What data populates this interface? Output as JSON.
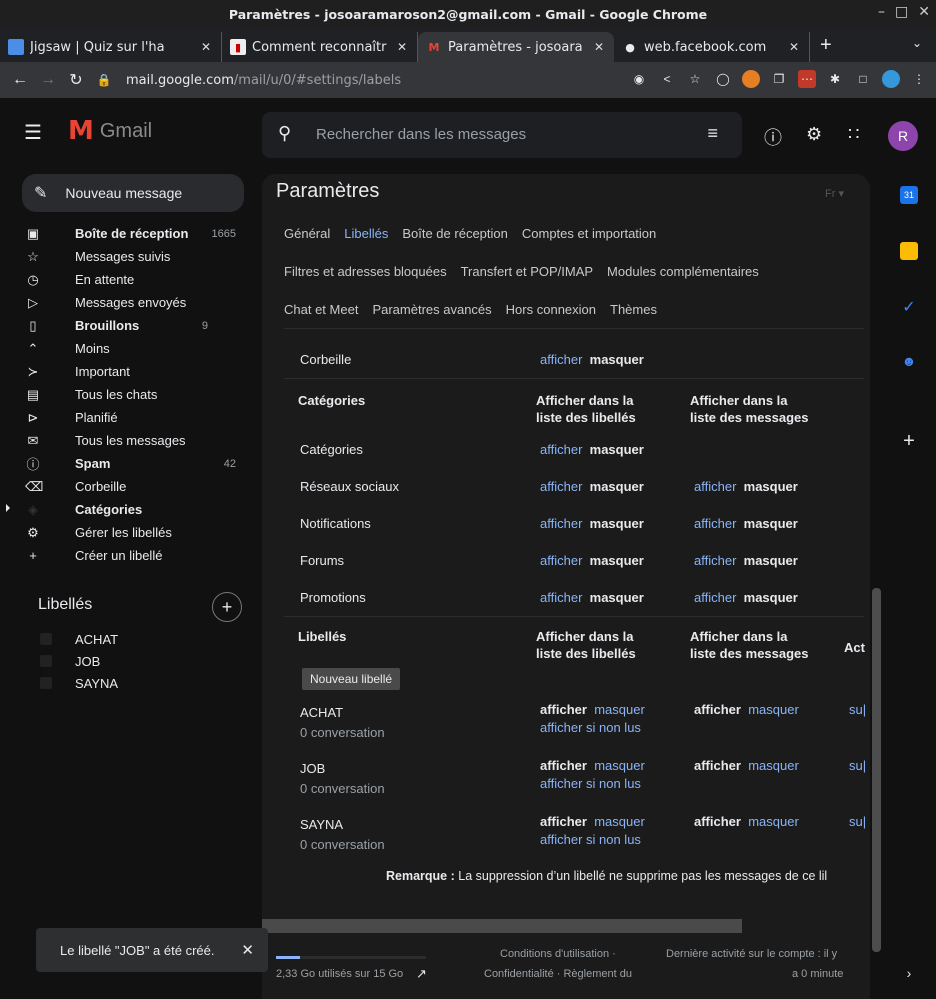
{
  "window": {
    "title": "Paramètres - josoaramaroson2@gmail.com - Gmail - Google Chrome"
  },
  "tabs": [
    {
      "title": "Jigsaw | Quiz sur l'ha",
      "icon": "jigsaw-icon"
    },
    {
      "title": "Comment reconnaîtr",
      "icon": "article-icon"
    },
    {
      "title": "Paramètres - josoara",
      "icon": "gmail-icon",
      "active": true
    },
    {
      "title": "web.facebook.com",
      "icon": "globe-icon"
    }
  ],
  "toolbar": {
    "url_host": "mail.google.com",
    "url_path": "/mail/u/0/#settings/labels"
  },
  "header": {
    "logo_text": "Gmail",
    "search_placeholder": "Rechercher dans les messages",
    "avatar_letter": "R"
  },
  "sidebar": {
    "compose": "Nouveau message",
    "items": [
      {
        "label": "Boîte de réception",
        "count": "1665",
        "bold": true,
        "icon": "inbox-icon"
      },
      {
        "label": "Messages suivis",
        "count": "",
        "icon": "star-icon"
      },
      {
        "label": "En attente",
        "count": "",
        "icon": "clock-icon"
      },
      {
        "label": "Messages envoyés",
        "count": "",
        "icon": "send-icon"
      },
      {
        "label": "Brouillons",
        "count": "9",
        "bold": true,
        "icon": "draft-icon"
      },
      {
        "label": "Moins",
        "count": "",
        "icon": "chevron-up-icon"
      },
      {
        "label": "Important",
        "count": "",
        "icon": "important-icon"
      },
      {
        "label": "Tous les chats",
        "count": "",
        "icon": "chat-icon"
      },
      {
        "label": "Planifié",
        "count": "",
        "icon": "scheduled-icon"
      },
      {
        "label": "Tous les messages",
        "count": "",
        "icon": "all-mail-icon"
      },
      {
        "label": "Spam",
        "count": "42",
        "bold": true,
        "icon": "spam-icon"
      },
      {
        "label": "Corbeille",
        "count": "",
        "icon": "trash-icon"
      },
      {
        "label": "Catégories",
        "count": "",
        "bold": true,
        "icon": "label-icon"
      },
      {
        "label": "Gérer les libellés",
        "count": "",
        "icon": "gear-icon"
      },
      {
        "label": "Créer un libellé",
        "count": "",
        "icon": "plus-icon"
      }
    ],
    "labels_header": "Libellés",
    "user_labels": [
      "ACHAT",
      "JOB",
      "SAYNA"
    ]
  },
  "settings": {
    "title": "Paramètres",
    "lang": "Fr",
    "tabs_row1": [
      "Général",
      "Libellés",
      "Boîte de réception",
      "Comptes et importation"
    ],
    "tabs_row2": [
      "Filtres et adresses bloquées",
      "Transfert et POP/IMAP",
      "Modules complémentaires"
    ],
    "tabs_row3": [
      "Chat et Meet",
      "Paramètres avancés",
      "Hors connexion",
      "Thèmes"
    ],
    "active_tab": "Libellés",
    "show": "afficher",
    "hide": "masquer",
    "show_if_unread": "afficher si non lus",
    "delete_truncated": "su|",
    "trash_row": "Corbeille",
    "categories_header": "Catégories",
    "col_labels_list": [
      "Afficher dans la",
      "liste des libellés"
    ],
    "col_messages_list": [
      "Afficher dans la",
      "liste des messages"
    ],
    "col_actions": "Act",
    "category_rows": [
      "Catégories",
      "Réseaux sociaux",
      "Notifications",
      "Forums",
      "Promotions"
    ],
    "labels_header": "Libellés",
    "new_label_button": "Nouveau libellé",
    "label_rows": [
      {
        "name": "ACHAT",
        "sub": "0 conversation"
      },
      {
        "name": "JOB",
        "sub": "0 conversation"
      },
      {
        "name": "SAYNA",
        "sub": "0 conversation"
      }
    ],
    "note_bold": "Remarque :",
    "note_text": " La suppression d’un libellé ne supprime pas les messages de ce lil"
  },
  "footer": {
    "storage": "2,33 Go utilisés sur 15 Go",
    "storage_fraction": 0.16,
    "terms_1": "Conditions d'utilisation ·",
    "terms_2": "Confidentialité · Règlement du",
    "activity_1": "Dernière activité sur le compte : il y",
    "activity_2": "a 0 minute"
  },
  "snackbar": {
    "message": "Le libellé \"JOB\" a été créé."
  },
  "colors": {
    "accent": "#8ab4f8",
    "gmail_red": "#ea4335",
    "avatar": "#8e44ad"
  }
}
